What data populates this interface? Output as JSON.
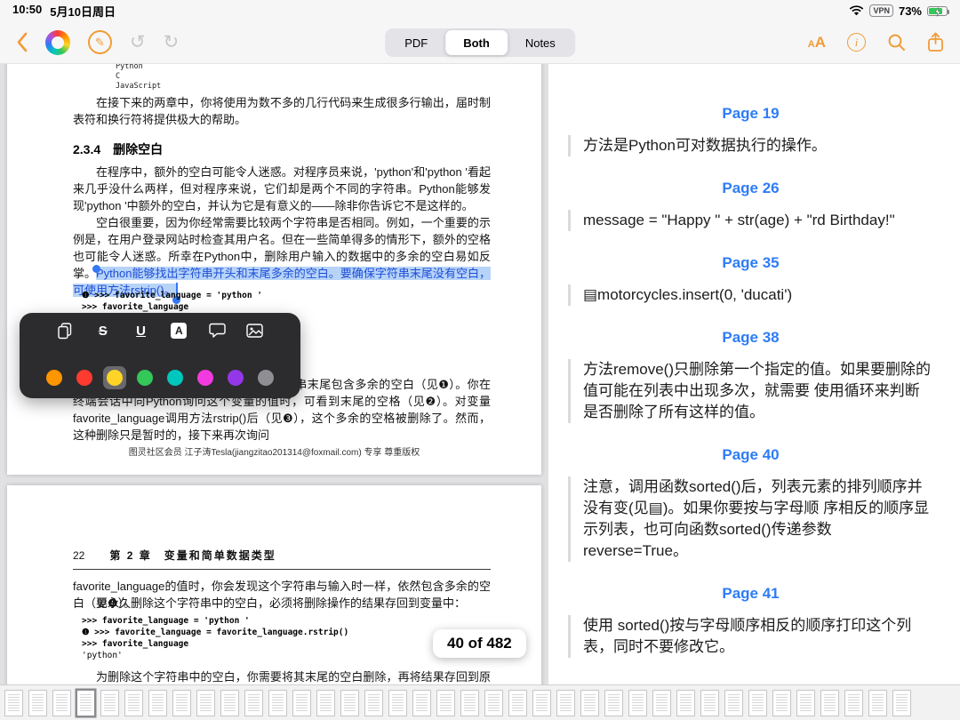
{
  "colors": {
    "accent_orange": "#F09C35",
    "note_blue": "#2E7CF6",
    "selection_bg": "#B7D3F8",
    "selection_text": "#1C4ED8",
    "swatches": [
      "#FF9500",
      "#FF3B30",
      "#FFD426",
      "#34C759",
      "#00C7BE",
      "#F23BDF",
      "#9437E8",
      "#8E8E93"
    ],
    "swatch_selected_index": 2
  },
  "status_bar": {
    "time": "10:50",
    "date": "5月10日周日",
    "vpn_label": "VPN",
    "battery_percent": "73%"
  },
  "toolbar": {
    "segments": [
      "PDF",
      "Both",
      "Notes"
    ],
    "selected_segment": "Both",
    "text_size_label": "AA"
  },
  "annotation_toolbar": {
    "icons": [
      "copy",
      "strikethrough",
      "underline",
      "highlight-style",
      "comment",
      "image"
    ],
    "strikethrough_label": "S",
    "underline_label": "U",
    "highlight_label": "A"
  },
  "pdf": {
    "page1": {
      "top_code": [
        "Python",
        "C",
        "JavaScript"
      ],
      "para_intro": "在接下来的两章中，你将使用为数不多的几行代码来生成很多行输出，届时制表符和换行符将提供极大的帮助。",
      "heading": "2.3.4　删除空白",
      "para_1": "在程序中，额外的空白可能令人迷惑。对程序员来说，'python'和'python '看起来几乎没什么两样，但对程序来说，它们却是两个不同的字符串。Python能够发现'python '中额外的空白，并认为它是有意义的——除非你告诉它不是这样的。",
      "para_2": "空白很重要，因为你经常需要比较两个字符串是否相同。例如，一个重要的示例是，在用户登录网站时检查其用户名。但在一些简单得多的情形下，额外的空格也可能令人迷惑。所幸在Python中，删除用户输入的数据中的多余的空白易如反掌。",
      "highlight_sentence": "Python能够找出字符串开头和末尾多余的空白。要确保字符串末尾没有空白，可使用方法rstrip()。",
      "code_lines": [
        "❶ >>> favorite_language = 'python '",
        ">>> favorite_language"
      ],
      "para_3": "存储在变量favorite_language中的字符串末尾包含多余的空白（见❶）。你在终端会话中向Python询问这个变量的值时，可看到末尾的空格（见❷）。对变量favorite_language调用方法rstrip()后（见❸），这个多余的空格被删除了。然而，这种删除只是暂时的，接下来再次询问",
      "footer": "图灵社区会员 江子涛Tesla(jiangzitao201314@foxmail.com) 专享 尊重版权"
    },
    "page2": {
      "page_number": "22",
      "chapter": "第 2 章　变量和简单数据类型",
      "para_1": "favorite_language的值时，你会发现这个字符串与输入时一样，依然包含多余的空白（见❹）。",
      "para_2": "要永久删除这个字符串中的空白，必须将删除操作的结果存回到变量中：",
      "code_lines": [
        ">>> favorite_language = 'python '",
        "❶ >>> favorite_language = favorite_language.rstrip()",
        ">>> favorite_language",
        "'python'"
      ],
      "para_3": "为删除这个字符串中的空白，你需要将其末尾的空白删除，再将结果存回到原来的变量中（见"
    },
    "page_indicator": "40 of 482"
  },
  "notes": [
    {
      "page": "Page 19",
      "text": "方法是Python可对数据执行的操作。"
    },
    {
      "page": "Page 26",
      "text": "message = \"Happy \" + str(age) + \"rd Birthday!\""
    },
    {
      "page": "Page 35",
      "text": "▤motorcycles.insert(0, 'ducati')"
    },
    {
      "page": "Page 38",
      "text": "方法remove()只删除第一个指定的值。如果要删除的值可能在列表中出现多次，就需要 使用循环来判断是否删除了所有这样的值。"
    },
    {
      "page": "Page 40",
      "text": "注意，调用函数sorted()后，列表元素的排列顺序并没有变(见▤)。如果你要按与字母顺 序相反的顺序显示列表，也可向函数sorted()传递参数reverse=True。"
    },
    {
      "page": "Page 41",
      "text": "使用 sorted()按与字母顺序相反的顺序打印这个列表，同时不要修改它。"
    }
  ],
  "thumbnail_strip": {
    "count": 38,
    "selected_index": 3
  }
}
